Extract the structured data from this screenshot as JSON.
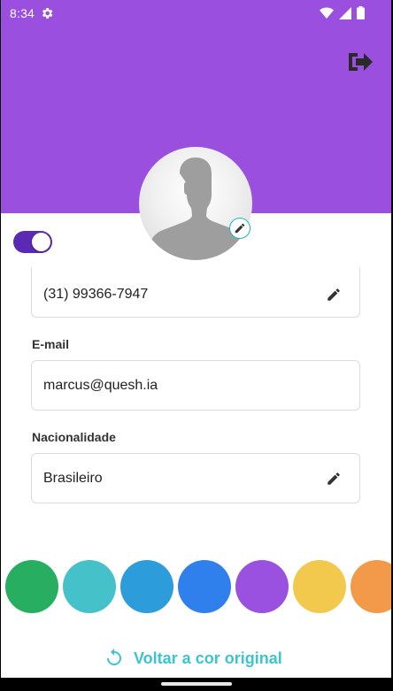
{
  "status_bar": {
    "time": "8:34",
    "icons": [
      "gear-icon",
      "wifi-icon",
      "signal-icon",
      "battery-icon"
    ]
  },
  "header": {
    "color": "#9b4fde",
    "logout_icon": "logout-icon"
  },
  "profile": {
    "avatar_icon": "default-avatar-silhouette",
    "edit_icon": "pencil-icon"
  },
  "toggle": {
    "on": true,
    "color": "#5a2ab5"
  },
  "form": {
    "phone": {
      "value": "(31) 99366-7947",
      "icon": "pencil-icon"
    },
    "email": {
      "label": "E-mail",
      "value": "marcus@quesh.ia"
    },
    "nationality": {
      "label": "Nacionalidade",
      "value": "Brasileiro",
      "icon": "pencil-icon"
    }
  },
  "color_swatches": [
    "#27ae60",
    "#45c1c9",
    "#2d9cdb",
    "#2f80ed",
    "#9b51e0",
    "#f2c94c",
    "#f2994a"
  ],
  "reset": {
    "label": "Voltar a cor original",
    "icon": "refresh-icon",
    "color": "#3ec3cf"
  }
}
